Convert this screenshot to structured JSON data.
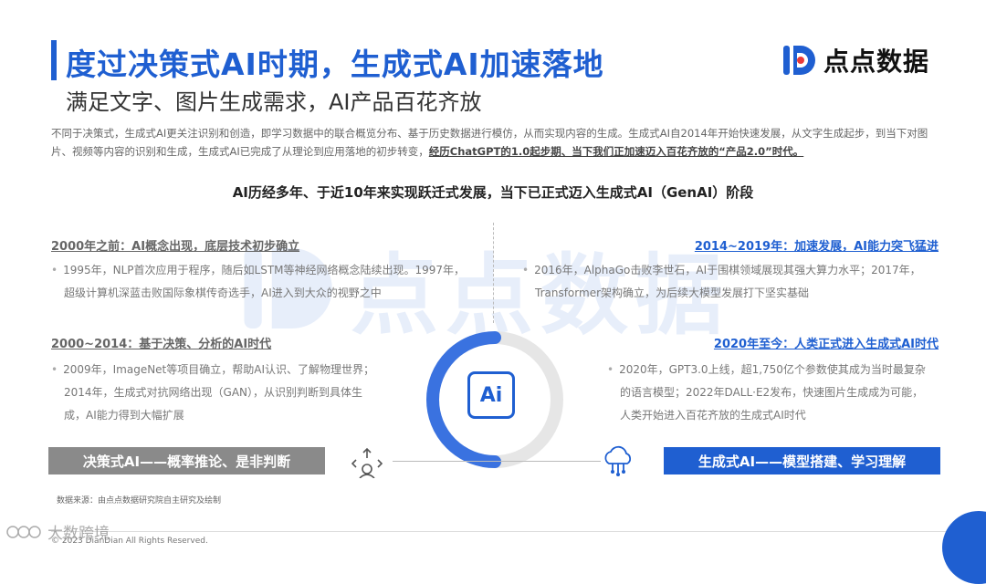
{
  "header": {
    "title": "度过决策式AI时期，生成式AI加速落地",
    "subtitle": "满足文字、图片生成需求，AI产品百花齐放"
  },
  "brand": {
    "logo_text": "点点数据",
    "watermark_text": "点点数据",
    "accent_color": "#1f5fd1"
  },
  "intro": {
    "text": "不同于决策式，生成式AI更关注识别和创造，即学习数据中的联合概览分布、基于历史数据进行模仿，从而实现内容的生成。生成式AI自2014年开始快速发展，从文字生成起步，到当下对图片、视频等内容的识别和生成，生成式AI已完成了从理论到应用落地的初步转变，",
    "highlight": "经历ChatGPT的1.0起步期、当下我们正加速迈入百花齐放的“产品2.0”时代。"
  },
  "headline": "AI历经多年、于近10年来实现跃迁式发展，当下已正式迈入生成式AI（GenAI）阶段",
  "sections": {
    "s2000_before": {
      "title": "2000年之前：AI概念出现，底层技术初步确立",
      "line1": "1995年，NLP首次应用于程序，随后如LSTM等神经网络概念陆续出现。1997年，",
      "line2": "超级计算机深蓝击败国际象棋传奇选手，AI进入到大众的视野之中"
    },
    "s2000_2014": {
      "title": "2000~2014：基于决策、分析的AI时代",
      "line1": "2009年，ImageNet等项目确立，帮助AI认识、了解物理世界；",
      "line2": "2014年，生成式对抗网络出现（GAN），从识别判断到具体生",
      "line3": "成，AI能力得到大幅扩展"
    },
    "s2014_2019": {
      "title": "2014~2019年：加速发展，AI能力突飞猛进",
      "line1": "2016年，AlphaGo击败李世石，AI于围棋领域展现其强大算力水平；2017年，",
      "line2": "Transformer架构确立，为后续大模型发展打下坚实基础"
    },
    "s2020_now": {
      "title": "2020年至今：人类正式进入生成式AI时代",
      "line1": "2020年，GPT3.0上线，超1,750亿个参数使其成为当时最复杂",
      "line2": "的语言模型；2022年DALL·E2发布，快速图片生成成为可能，",
      "line3": "人类开始进入百花齐放的生成式AI时代"
    }
  },
  "center": {
    "ai_label": "Ai"
  },
  "banners": {
    "left": "决策式AI——概率推论、是非判断",
    "right": "生成式AI——模型搭建、学习理解"
  },
  "source": "数据来源：由点点数据研究院自主研究及绘制",
  "footer": "© 2023 DianDian All Rights Reserved.",
  "overlay_watermark": "大数跨境"
}
